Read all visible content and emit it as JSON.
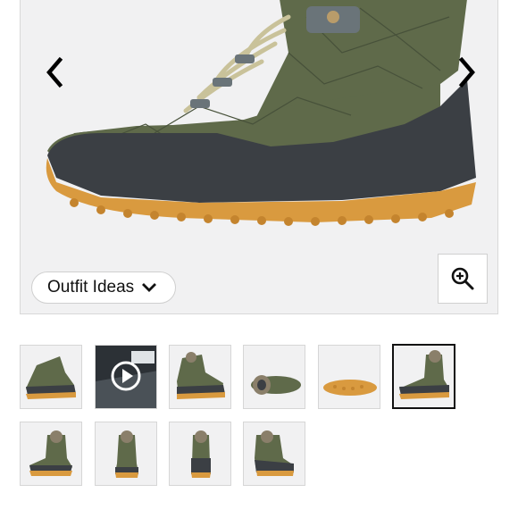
{
  "gallery": {
    "outfit_button_label": "Outfit Ideas",
    "icons": {
      "prev": "chevron-left-icon",
      "next": "chevron-right-icon",
      "outfit_dropdown": "chevron-down-icon",
      "zoom": "zoom-in-icon",
      "video_play": "play-icon"
    },
    "colors": {
      "boot_upper": "#5f6a4a",
      "boot_rubber": "#3b3f44",
      "boot_sole": "#d99a3f",
      "lace": "#c9c29a"
    },
    "thumbnails": [
      {
        "view": "side",
        "type": "image",
        "selected": false
      },
      {
        "view": "waterproof-video",
        "type": "video",
        "selected": false
      },
      {
        "view": "side-alt",
        "type": "image",
        "selected": false
      },
      {
        "view": "top",
        "type": "image",
        "selected": false
      },
      {
        "view": "sole",
        "type": "image",
        "selected": false
      },
      {
        "view": "side-close",
        "type": "image",
        "selected": true
      },
      {
        "view": "front-angle",
        "type": "image",
        "selected": false
      },
      {
        "view": "front",
        "type": "image",
        "selected": false
      },
      {
        "view": "back",
        "type": "image",
        "selected": false
      },
      {
        "view": "rear-angle",
        "type": "image",
        "selected": false
      }
    ]
  }
}
